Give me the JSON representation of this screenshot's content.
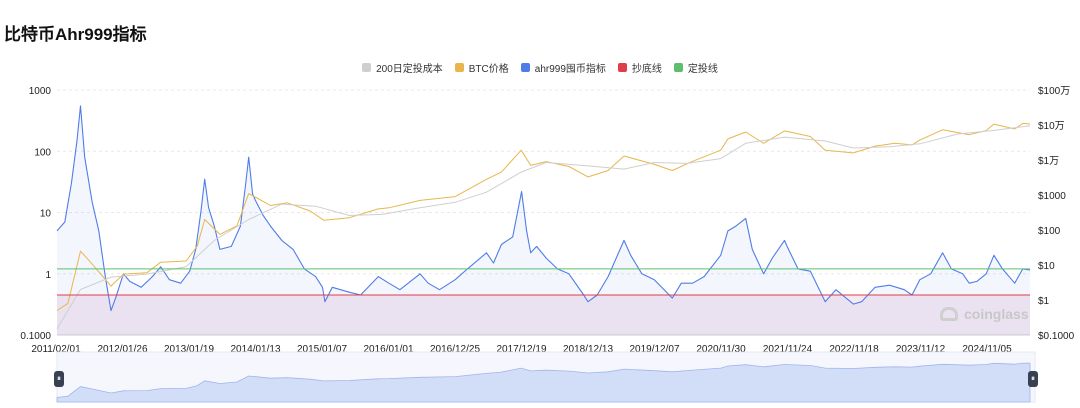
{
  "title": "比特币Ahr999指标",
  "legend": [
    {
      "label": "200日定投成本",
      "color": "#cfcfcf"
    },
    {
      "label": "BTC价格",
      "color": "#e8b64d"
    },
    {
      "label": "ahr999囤币指标",
      "color": "#4f7de8"
    },
    {
      "label": "抄底线",
      "color": "#e23b4a"
    },
    {
      "label": "定投线",
      "color": "#5cc06b"
    }
  ],
  "watermark": "coinglass",
  "chart_data": {
    "type": "line",
    "x_ticks": [
      "2011/02/01",
      "2012/01/26",
      "2013/01/19",
      "2014/01/13",
      "2015/01/07",
      "2016/01/01",
      "2016/12/25",
      "2017/12/19",
      "2018/12/13",
      "2019/12/07",
      "2020/11/30",
      "2021/11/24",
      "2022/11/18",
      "2023/11/12",
      "2024/11/05"
    ],
    "left_axis": {
      "scale": "log",
      "ticks": [
        "1000",
        "100",
        "10",
        "1",
        "0.1000"
      ],
      "range": [
        0.1,
        1000
      ]
    },
    "right_axis": {
      "scale": "log",
      "ticks": [
        "$100万",
        "$10万",
        "$1万",
        "$1000",
        "$100",
        "$10",
        "$1",
        "$0.1000"
      ],
      "range": [
        0.1,
        1000000
      ]
    },
    "thresholds": [
      {
        "name": "抄底线",
        "value": 0.45
      },
      {
        "name": "定投线",
        "value": 1.2
      }
    ],
    "series": [
      {
        "name": "ahr999囤币指标",
        "axis": "left",
        "color": "#4f7de8",
        "fill": true,
        "points": [
          [
            "2011-02-01",
            5
          ],
          [
            "2011-03-15",
            7
          ],
          [
            "2011-04-20",
            30
          ],
          [
            "2011-05-20",
            150
          ],
          [
            "2011-06-08",
            550
          ],
          [
            "2011-07-01",
            80
          ],
          [
            "2011-08-10",
            15
          ],
          [
            "2011-09-15",
            5
          ],
          [
            "2011-10-20",
            0.9
          ],
          [
            "2011-11-20",
            0.25
          ],
          [
            "2011-12-15",
            0.4
          ],
          [
            "2012-01-26",
            1.0
          ],
          [
            "2012-03-01",
            0.75
          ],
          [
            "2012-05-01",
            0.6
          ],
          [
            "2012-07-01",
            0.9
          ],
          [
            "2012-08-15",
            1.3
          ],
          [
            "2012-10-01",
            0.8
          ],
          [
            "2012-12-01",
            0.7
          ],
          [
            "2013-01-19",
            1.1
          ],
          [
            "2013-02-20",
            2.5
          ],
          [
            "2013-03-20",
            10
          ],
          [
            "2013-04-10",
            35
          ],
          [
            "2013-05-01",
            12
          ],
          [
            "2013-06-01",
            6
          ],
          [
            "2013-07-01",
            2.5
          ],
          [
            "2013-09-01",
            2.8
          ],
          [
            "2013-10-20",
            6
          ],
          [
            "2013-11-15",
            25
          ],
          [
            "2013-12-04",
            80
          ],
          [
            "2013-12-25",
            20
          ],
          [
            "2014-01-13",
            15
          ],
          [
            "2014-02-20",
            9
          ],
          [
            "2014-04-01",
            6
          ],
          [
            "2014-06-01",
            3.5
          ],
          [
            "2014-08-01",
            2.5
          ],
          [
            "2014-10-01",
            1.2
          ],
          [
            "2014-12-01",
            0.9
          ],
          [
            "2015-01-07",
            0.6
          ],
          [
            "2015-01-20",
            0.35
          ],
          [
            "2015-03-01",
            0.6
          ],
          [
            "2015-06-01",
            0.5
          ],
          [
            "2015-08-01",
            0.45
          ],
          [
            "2015-11-05",
            0.9
          ],
          [
            "2016-01-01",
            0.7
          ],
          [
            "2016-03-01",
            0.55
          ],
          [
            "2016-06-18",
            1.0
          ],
          [
            "2016-08-01",
            0.7
          ],
          [
            "2016-10-01",
            0.55
          ],
          [
            "2016-12-25",
            0.8
          ],
          [
            "2017-03-01",
            1.2
          ],
          [
            "2017-06-12",
            2.2
          ],
          [
            "2017-07-20",
            1.5
          ],
          [
            "2017-09-01",
            3
          ],
          [
            "2017-11-01",
            4
          ],
          [
            "2017-12-19",
            22
          ],
          [
            "2018-01-15",
            5
          ],
          [
            "2018-02-06",
            2.2
          ],
          [
            "2018-03-10",
            2.8
          ],
          [
            "2018-05-01",
            1.8
          ],
          [
            "2018-07-01",
            1.2
          ],
          [
            "2018-09-01",
            1.0
          ],
          [
            "2018-11-20",
            0.45
          ],
          [
            "2018-12-13",
            0.35
          ],
          [
            "2019-02-01",
            0.45
          ],
          [
            "2019-04-01",
            0.9
          ],
          [
            "2019-06-26",
            3.5
          ],
          [
            "2019-08-01",
            2.0
          ],
          [
            "2019-10-01",
            1.0
          ],
          [
            "2019-12-07",
            0.8
          ],
          [
            "2020-03-13",
            0.4
          ],
          [
            "2020-05-01",
            0.7
          ],
          [
            "2020-07-01",
            0.7
          ],
          [
            "2020-09-01",
            0.9
          ],
          [
            "2020-11-30",
            2.0
          ],
          [
            "2021-01-08",
            5
          ],
          [
            "2021-02-20",
            6
          ],
          [
            "2021-04-14",
            8
          ],
          [
            "2021-05-20",
            2.5
          ],
          [
            "2021-07-20",
            1.0
          ],
          [
            "2021-09-05",
            1.8
          ],
          [
            "2021-11-10",
            3.5
          ],
          [
            "2021-11-24",
            2.8
          ],
          [
            "2022-01-22",
            1.2
          ],
          [
            "2022-03-30",
            1.1
          ],
          [
            "2022-06-18",
            0.35
          ],
          [
            "2022-08-15",
            0.55
          ],
          [
            "2022-11-18",
            0.32
          ],
          [
            "2023-01-01",
            0.35
          ],
          [
            "2023-03-15",
            0.6
          ],
          [
            "2023-06-01",
            0.65
          ],
          [
            "2023-08-20",
            0.55
          ],
          [
            "2023-10-01",
            0.45
          ],
          [
            "2023-11-12",
            0.8
          ],
          [
            "2024-01-10",
            1.0
          ],
          [
            "2024-03-14",
            2.2
          ],
          [
            "2024-05-01",
            1.2
          ],
          [
            "2024-07-01",
            1.0
          ],
          [
            "2024-08-05",
            0.7
          ],
          [
            "2024-09-15",
            0.75
          ],
          [
            "2024-11-05",
            1.0
          ],
          [
            "2024-12-17",
            2.0
          ],
          [
            "2025-02-01",
            1.2
          ],
          [
            "2025-04-08",
            0.7
          ],
          [
            "2025-05-22",
            1.2
          ],
          [
            "2025-06-30",
            1.15
          ]
        ]
      },
      {
        "name": "BTC价格",
        "axis": "right",
        "color": "#e8b64d",
        "points": [
          [
            "2011-02-01",
            0.5
          ],
          [
            "2011-04-01",
            0.8
          ],
          [
            "2011-06-08",
            25
          ],
          [
            "2011-08-01",
            12
          ],
          [
            "2011-11-20",
            2.5
          ],
          [
            "2012-01-26",
            5.5
          ],
          [
            "2012-06-01",
            6
          ],
          [
            "2012-08-15",
            12
          ],
          [
            "2012-12-31",
            13
          ],
          [
            "2013-03-01",
            35
          ],
          [
            "2013-04-10",
            200
          ],
          [
            "2013-07-01",
            75
          ],
          [
            "2013-10-01",
            130
          ],
          [
            "2013-12-04",
            1100
          ],
          [
            "2014-01-13",
            850
          ],
          [
            "2014-04-01",
            500
          ],
          [
            "2014-07-01",
            600
          ],
          [
            "2014-11-01",
            350
          ],
          [
            "2015-01-14",
            190
          ],
          [
            "2015-06-01",
            225
          ],
          [
            "2015-11-05",
            400
          ],
          [
            "2016-01-01",
            430
          ],
          [
            "2016-06-18",
            700
          ],
          [
            "2016-12-25",
            900
          ],
          [
            "2017-06-12",
            2800
          ],
          [
            "2017-09-01",
            4500
          ],
          [
            "2017-12-17",
            19000
          ],
          [
            "2018-02-06",
            7000
          ],
          [
            "2018-05-01",
            9000
          ],
          [
            "2018-09-01",
            6500
          ],
          [
            "2018-12-13",
            3300
          ],
          [
            "2019-04-01",
            5000
          ],
          [
            "2019-06-26",
            13000
          ],
          [
            "2019-12-07",
            7500
          ],
          [
            "2020-03-13",
            5000
          ],
          [
            "2020-07-01",
            9200
          ],
          [
            "2020-11-30",
            19000
          ],
          [
            "2021-01-08",
            40000
          ],
          [
            "2021-04-14",
            63000
          ],
          [
            "2021-07-20",
            30000
          ],
          [
            "2021-11-10",
            68000
          ],
          [
            "2022-03-30",
            47000
          ],
          [
            "2022-06-18",
            19000
          ],
          [
            "2022-11-18",
            16000
          ],
          [
            "2023-03-15",
            25000
          ],
          [
            "2023-07-01",
            30000
          ],
          [
            "2023-10-01",
            27000
          ],
          [
            "2023-11-12",
            37000
          ],
          [
            "2024-03-14",
            73000
          ],
          [
            "2024-08-05",
            53000
          ],
          [
            "2024-11-05",
            69000
          ],
          [
            "2024-12-17",
            106000
          ],
          [
            "2025-04-08",
            77000
          ],
          [
            "2025-05-22",
            111000
          ],
          [
            "2025-06-30",
            107000
          ]
        ]
      },
      {
        "name": "200日定投成本",
        "axis": "right",
        "color": "#cfcfcf",
        "points": [
          [
            "2011-02-01",
            0.15
          ],
          [
            "2011-06-08",
            2
          ],
          [
            "2011-11-20",
            4.5
          ],
          [
            "2012-06-01",
            5.5
          ],
          [
            "2012-12-31",
            9
          ],
          [
            "2013-06-01",
            50
          ],
          [
            "2013-12-04",
            200
          ],
          [
            "2014-06-01",
            550
          ],
          [
            "2014-12-01",
            480
          ],
          [
            "2015-06-01",
            260
          ],
          [
            "2015-12-01",
            280
          ],
          [
            "2016-06-01",
            420
          ],
          [
            "2016-12-25",
            620
          ],
          [
            "2017-06-12",
            1200
          ],
          [
            "2017-12-17",
            4500
          ],
          [
            "2018-05-01",
            8500
          ],
          [
            "2018-12-13",
            6800
          ],
          [
            "2019-06-26",
            5500
          ],
          [
            "2019-12-07",
            8500
          ],
          [
            "2020-06-01",
            8000
          ],
          [
            "2020-11-30",
            11000
          ],
          [
            "2021-04-14",
            30000
          ],
          [
            "2021-11-10",
            45000
          ],
          [
            "2022-06-18",
            35000
          ],
          [
            "2022-11-18",
            22000
          ],
          [
            "2023-06-01",
            24000
          ],
          [
            "2023-11-12",
            29000
          ],
          [
            "2024-06-01",
            55000
          ],
          [
            "2024-12-17",
            70000
          ],
          [
            "2025-06-30",
            95000
          ]
        ]
      }
    ],
    "navigator": {
      "series": "BTC价格"
    }
  }
}
